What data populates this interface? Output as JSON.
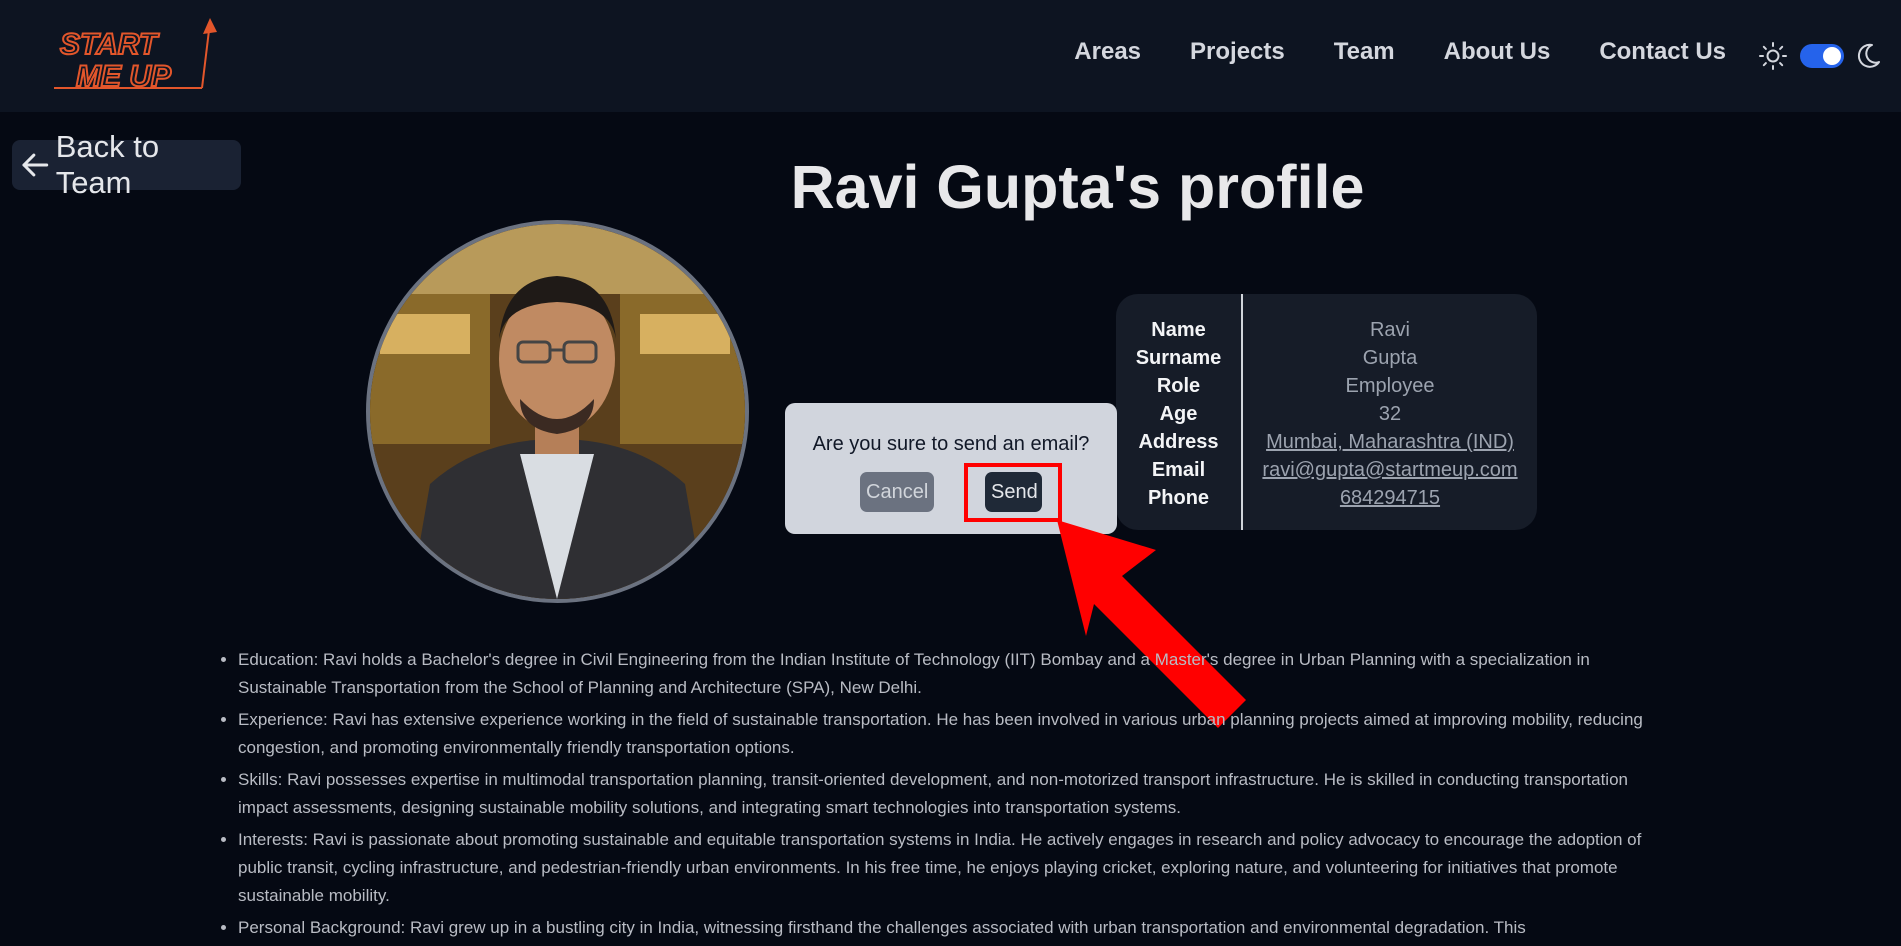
{
  "brand": {
    "logo_text": "START ME UP",
    "logo_color": "#e2562b"
  },
  "nav": {
    "items": [
      {
        "label": "Areas"
      },
      {
        "label": "Projects"
      },
      {
        "label": "Team"
      },
      {
        "label": "About Us"
      },
      {
        "label": "Contact Us"
      }
    ],
    "theme_toggle_on": true
  },
  "back_button": {
    "label": "Back to Team"
  },
  "page_title": "Ravi Gupta's profile",
  "profile": {
    "labels": [
      "Name",
      "Surname",
      "Role",
      "Age",
      "Address",
      "Email",
      "Phone"
    ],
    "values": [
      "Ravi",
      "Gupta",
      "Employee",
      "32",
      "Mumbai, Maharashtra (IND)",
      "ravi@gupta@startmeup.com",
      "684294715"
    ]
  },
  "dialog": {
    "message": "Are you sure to send an email?",
    "cancel_label": "Cancel",
    "send_label": "Send"
  },
  "annotation": {
    "color": "#ff0000"
  },
  "bio": [
    "Education: Ravi holds a Bachelor's degree in Civil Engineering from the Indian Institute of Technology (IIT) Bombay and a Master's degree in Urban Planning with a specialization in Sustainable Transportation from the School of Planning and Architecture (SPA), New Delhi.",
    "Experience: Ravi has extensive experience working in the field of sustainable transportation. He has been involved in various urban planning projects aimed at improving mobility, reducing congestion, and promoting environmentally friendly transportation options.",
    "Skills: Ravi possesses expertise in multimodal transportation planning, transit-oriented development, and non-motorized transport infrastructure. He is skilled in conducting transportation impact assessments, designing sustainable mobility solutions, and integrating smart technologies into transportation systems.",
    "Interests: Ravi is passionate about promoting sustainable and equitable transportation systems in India. He actively engages in research and policy advocacy to encourage the adoption of public transit, cycling infrastructure, and pedestrian-friendly urban environments. In his free time, he enjoys playing cricket, exploring nature, and volunteering for initiatives that promote sustainable mobility.",
    "Personal Background: Ravi grew up in a bustling city in India, witnessing firsthand the challenges associated with urban transportation and environmental degradation. This"
  ]
}
